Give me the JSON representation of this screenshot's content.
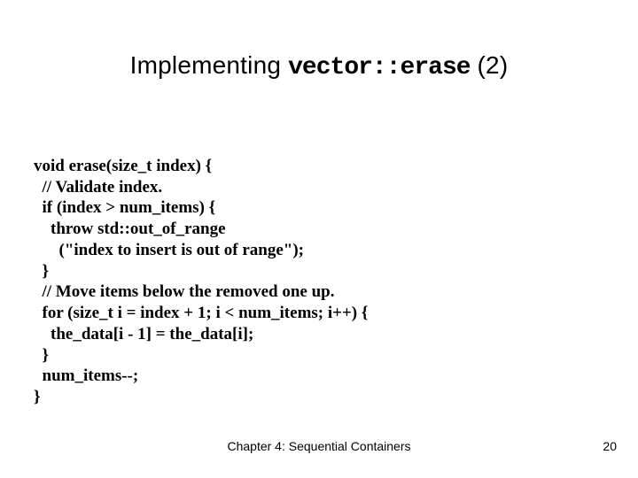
{
  "title": {
    "prefix": "Implementing ",
    "mono": "vector::erase",
    "suffix": " (2)"
  },
  "code_lines": [
    "void erase(size_t index) {",
    "  // Validate index.",
    "  if (index > num_items) {",
    "    throw std::out_of_range",
    "      (\"index to insert is out of range\");",
    "  }",
    "  // Move items below the removed one up.",
    "  for (size_t i = index + 1; i < num_items; i++) {",
    "    the_data[i - 1] = the_data[i];",
    "  }",
    "  num_items--;",
    "}"
  ],
  "footer": "Chapter 4: Sequential Containers",
  "page_number": "20"
}
